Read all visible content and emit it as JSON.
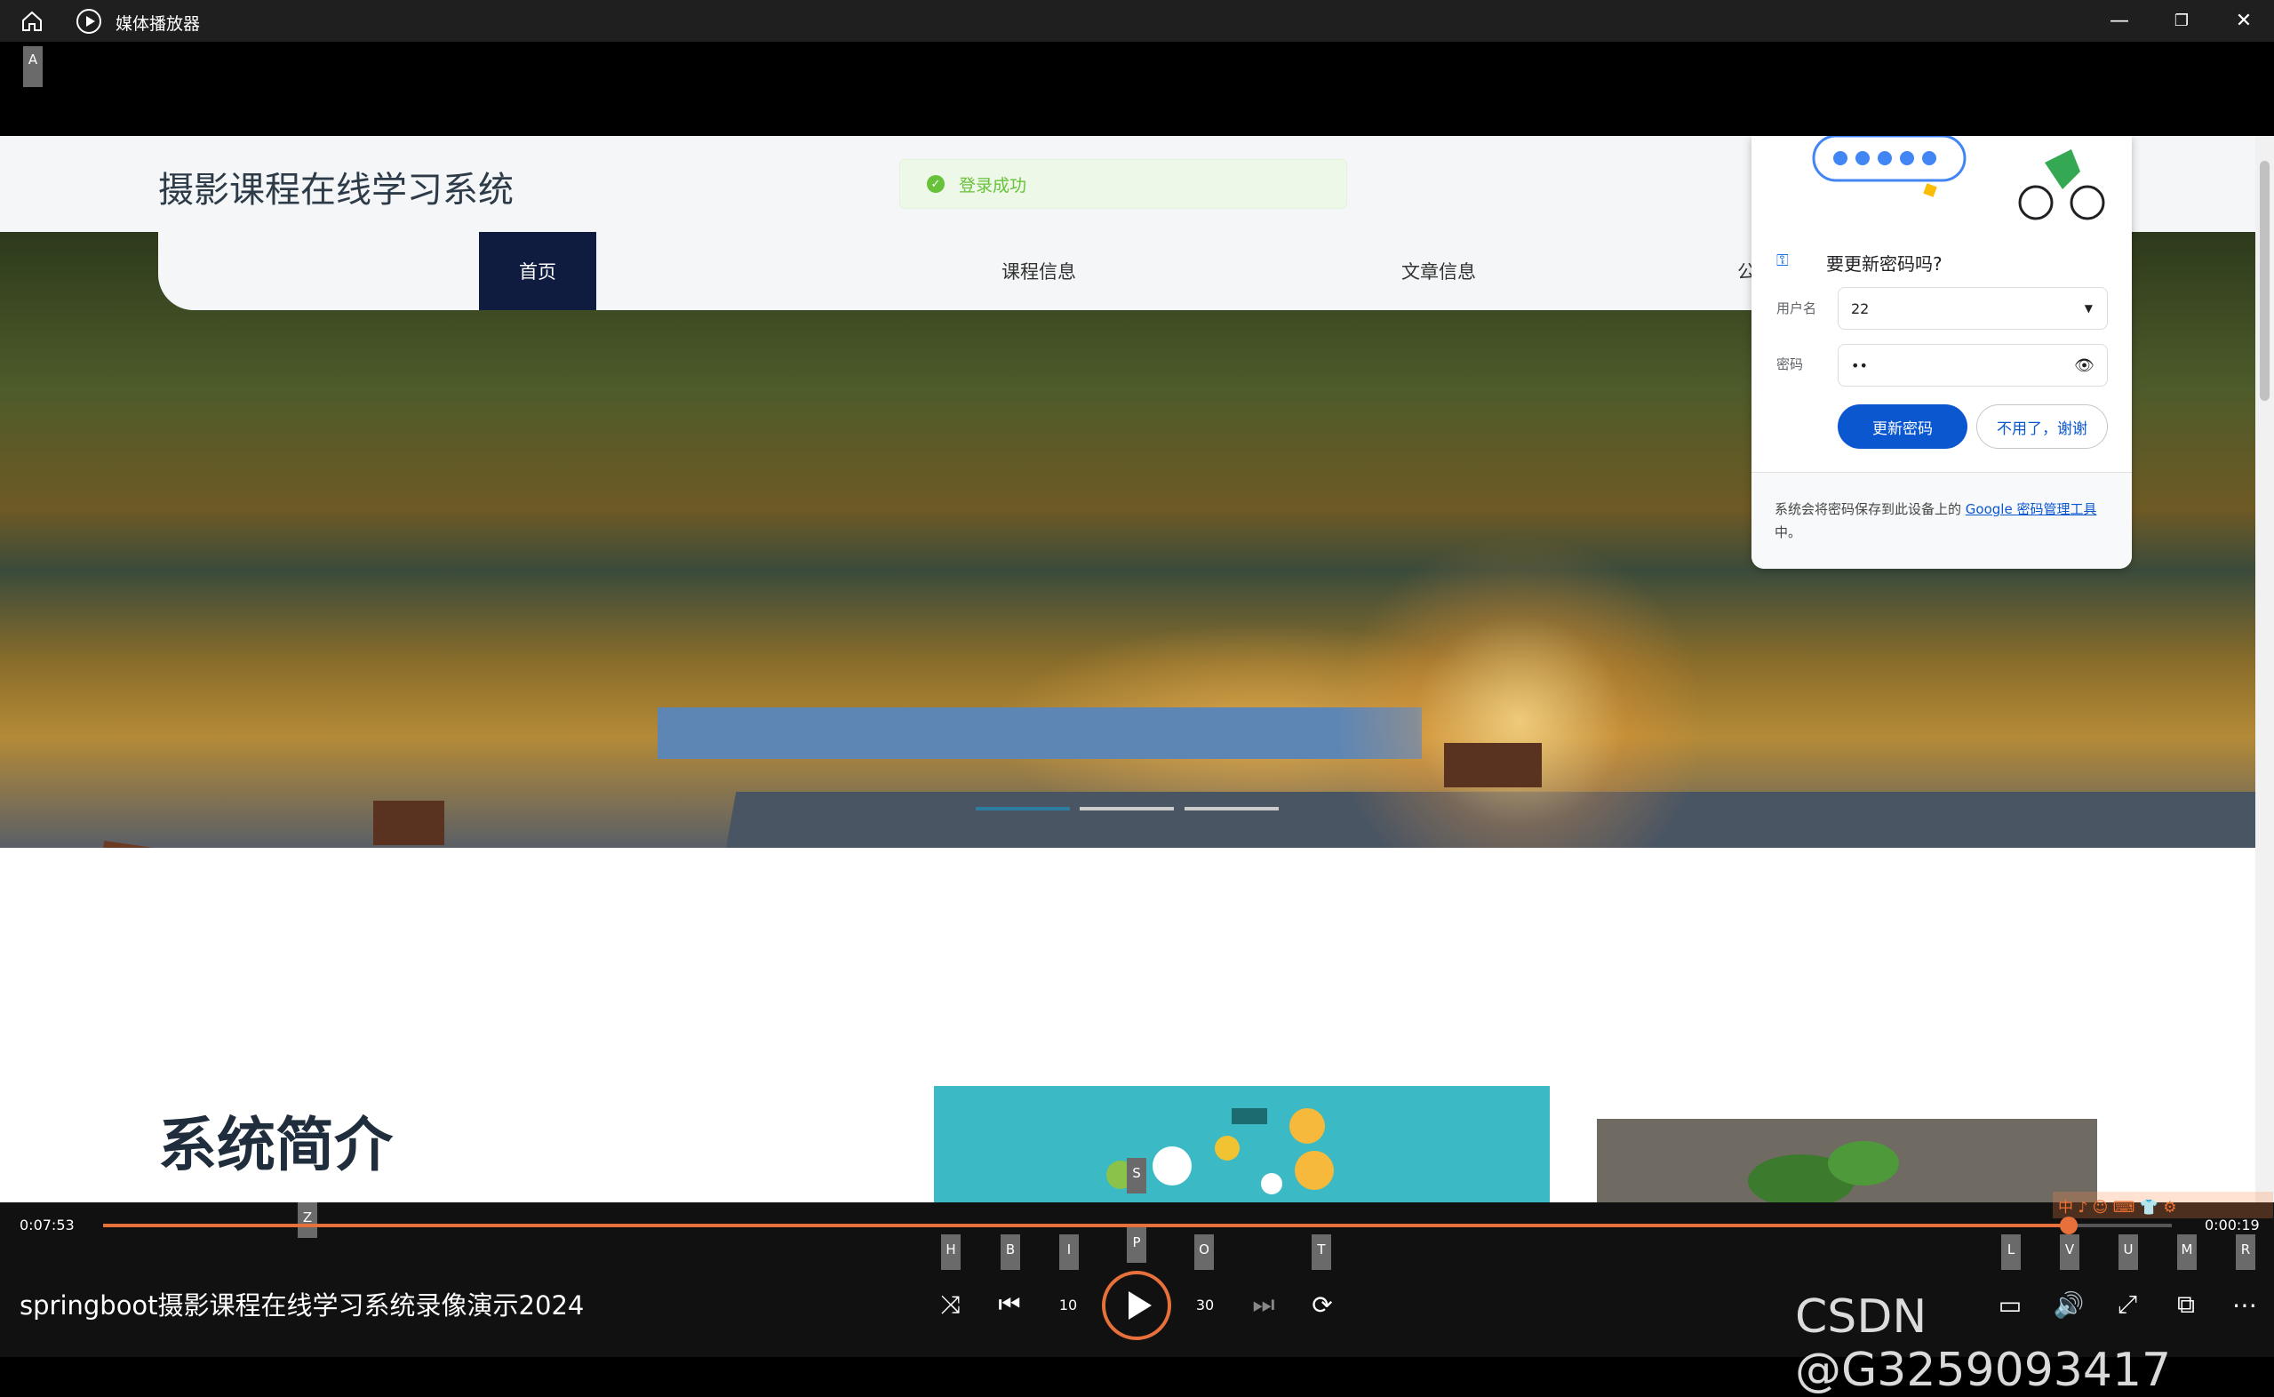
{
  "window": {
    "app_title": "媒体播放器",
    "minimize": "—",
    "restore": "❐",
    "close": "✕"
  },
  "keytips_top": {
    "a": "A"
  },
  "site": {
    "title": "摄影课程在线学习系统",
    "toast": "登录成功",
    "nav": [
      "首页",
      "课程信息",
      "文章信息",
      "公告信"
    ],
    "intro_heading": "系统简介"
  },
  "password_dialog": {
    "title": "要更新密码吗?",
    "username_label": "用户名",
    "username_value": "22",
    "password_label": "密码",
    "password_value": "••",
    "update_button": "更新密码",
    "no_button": "不用了，谢谢",
    "footer_prefix": "系统会将密码保存到此设备上的 ",
    "footer_link": "Google 密码管理工具",
    "footer_suffix": "中。"
  },
  "player": {
    "current_time": "0:07:53",
    "remaining_time": "0:00:19",
    "progress": 0.95,
    "video_title": "springboot摄影课程在线学习系统录像演示2024",
    "keytips": {
      "z": "Z",
      "h": "H",
      "b": "B",
      "i": "I",
      "p": "P",
      "s": "S",
      "o": "O",
      "t": "T",
      "l": "L",
      "v": "V",
      "u": "U",
      "m": "M",
      "r": "R"
    },
    "icons": [
      "shuffle-icon",
      "previous-icon",
      "rewind-10-icon",
      "play-icon",
      "forward-30-icon",
      "next-icon",
      "repeat-icon",
      "subtitles-icon",
      "volume-icon",
      "fullscreen-icon",
      "miniplayer-icon",
      "more-icon"
    ],
    "rewind_label": "10",
    "forward_label": "30"
  },
  "watermark": "CSDN @G3259093417",
  "ime_bar": "中 ♪ ☺ ⌨ 👕 ⚙",
  "colors": {
    "accent": "#e8713b",
    "nav_active": "#0f1c3f",
    "google_blue": "#0b57d0",
    "toast_green": "#67c23a"
  }
}
